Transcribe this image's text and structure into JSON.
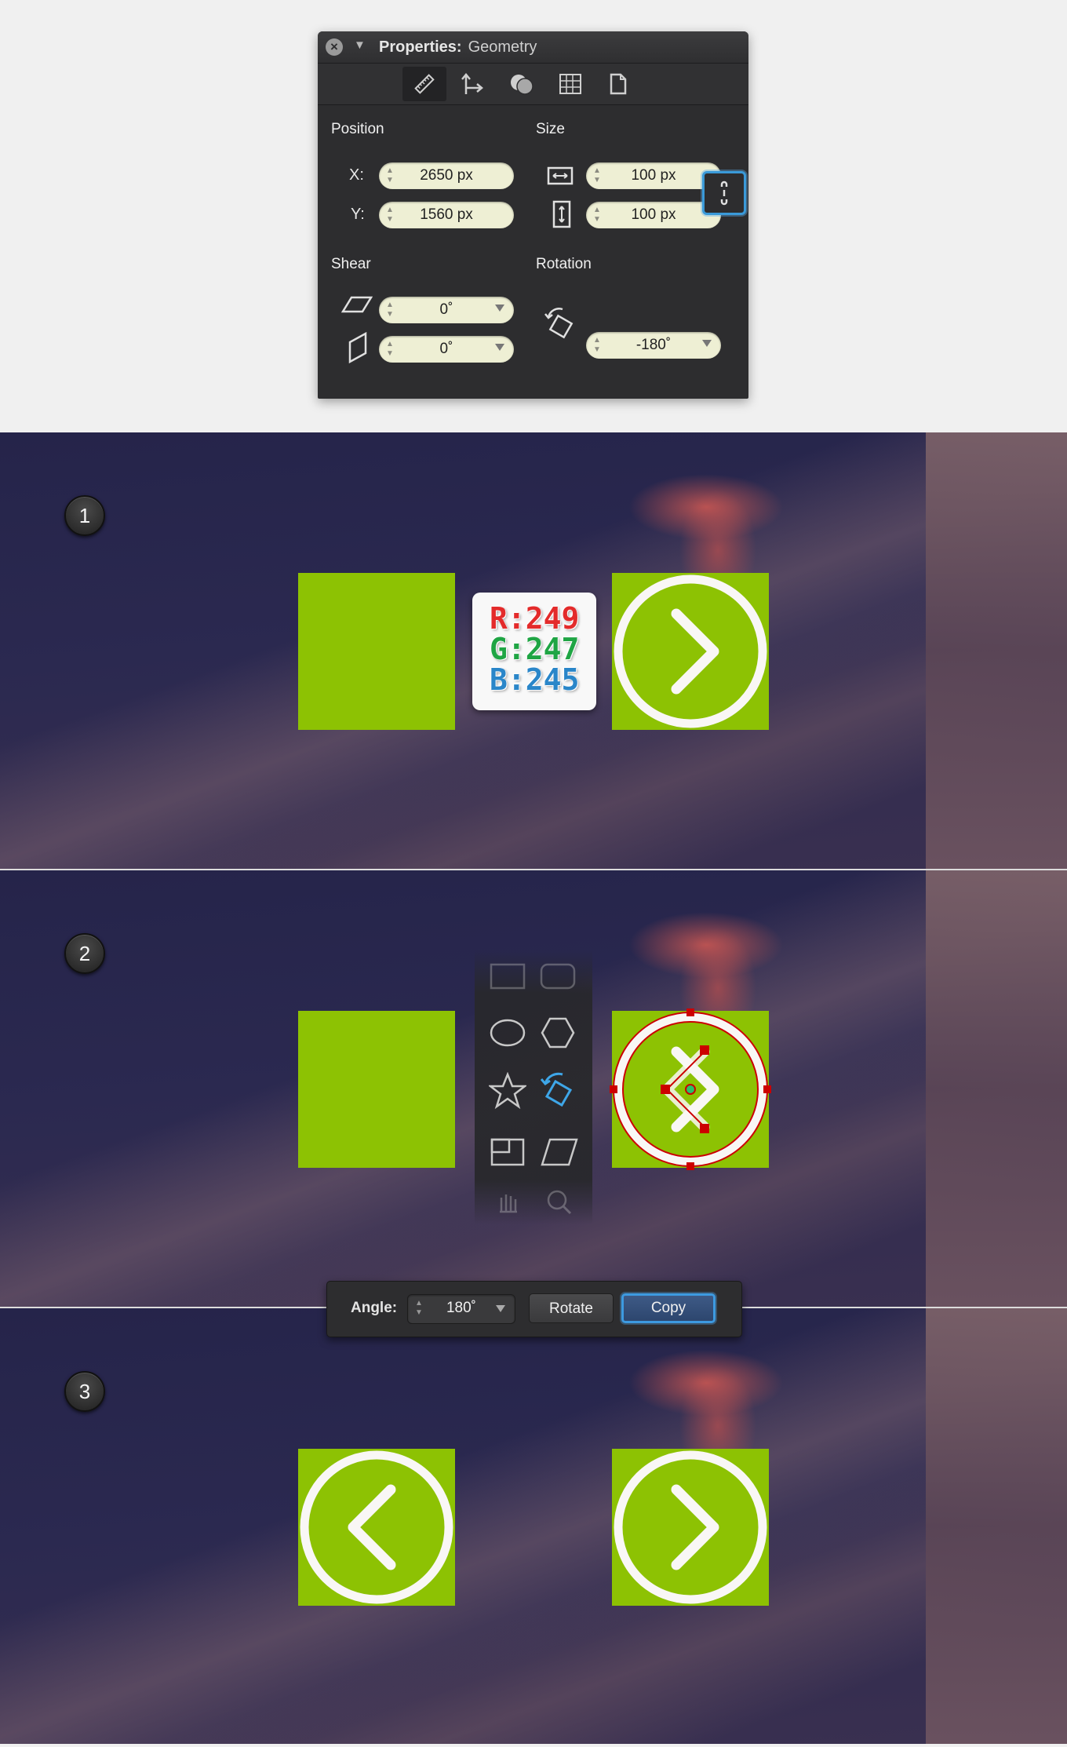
{
  "properties": {
    "title_label": "Properties:",
    "title_value": "Geometry",
    "toolbar_icons": [
      "ruler-icon",
      "move-icon",
      "shapes-icon",
      "grid-icon",
      "document-icon"
    ],
    "position": {
      "label": "Position",
      "x_label": "X:",
      "x_value": "2650 px",
      "y_label": "Y:",
      "y_value": "1560 px"
    },
    "size": {
      "label": "Size",
      "width_value": "100 px",
      "height_value": "100 px"
    },
    "shear": {
      "label": "Shear",
      "horizontal_value": "0˚",
      "vertical_value": "0˚"
    },
    "rotation": {
      "label": "Rotation",
      "value": "-180˚"
    }
  },
  "steps": [
    {
      "number": "1"
    },
    {
      "number": "2"
    },
    {
      "number": "3"
    }
  ],
  "rgb": {
    "r": "R:249",
    "g": "G:247",
    "b": "B:245",
    "r_color": "#e32b2b",
    "g_color": "#1fa544",
    "b_color": "#2a86c9"
  },
  "tools": [
    "rectangle-icon",
    "rounded-rectangle-icon",
    "ellipse-icon",
    "polygon-icon",
    "star-icon",
    "rotate-icon",
    "scale-icon",
    "shear-icon",
    "hand-icon",
    "zoom-icon"
  ],
  "angle_bar": {
    "label": "Angle:",
    "value": "180˚",
    "rotate_label": "Rotate",
    "copy_label": "Copy"
  },
  "colors": {
    "green": "#8dc203",
    "panel": "#2d2d2f",
    "accent": "#3d9ae0",
    "selection": "#cc0000"
  }
}
